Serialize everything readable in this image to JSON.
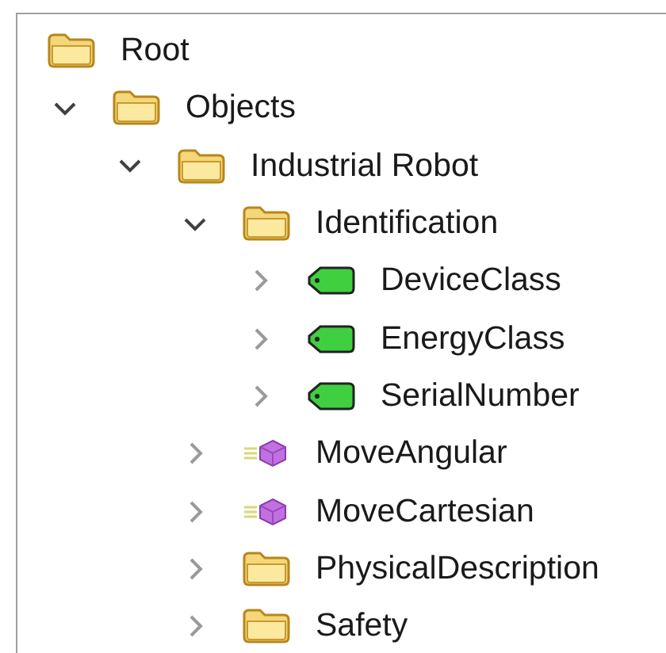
{
  "tree": [
    {
      "label": "Root",
      "kind": "folder",
      "children": [
        {
          "label": "Objects",
          "kind": "folder",
          "expanded": true,
          "children": [
            {
              "label": "Industrial Robot",
              "kind": "folder",
              "expanded": true,
              "children": [
                {
                  "label": "Identification",
                  "kind": "folder",
                  "expanded": true,
                  "children": [
                    {
                      "label": "DeviceClass",
                      "kind": "tag",
                      "expanded": false
                    },
                    {
                      "label": "EnergyClass",
                      "kind": "tag",
                      "expanded": false
                    },
                    {
                      "label": "SerialNumber",
                      "kind": "tag",
                      "expanded": false
                    }
                  ]
                },
                {
                  "label": "MoveAngular",
                  "kind": "method",
                  "expanded": false
                },
                {
                  "label": "MoveCartesian",
                  "kind": "method",
                  "expanded": false
                },
                {
                  "label": "PhysicalDescription",
                  "kind": "folder",
                  "expanded": false
                },
                {
                  "label": "Safety",
                  "kind": "folder",
                  "expanded": false
                }
              ]
            }
          ]
        }
      ]
    }
  ]
}
